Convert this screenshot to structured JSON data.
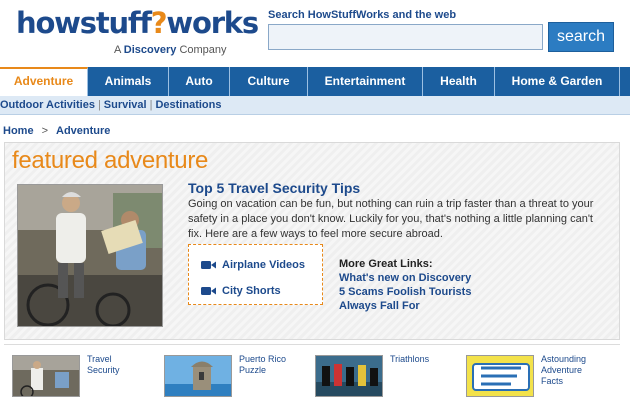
{
  "header": {
    "logo_text_part1": "howstuff",
    "logo_text_part2": "works",
    "logo_question": "?",
    "logo_tagline_prefix": "A",
    "logo_tagline_brand": "Discovery",
    "logo_tagline_suffix": "Company",
    "search_label": "Search HowStuffWorks and the web",
    "search_value": "",
    "search_button": "search"
  },
  "nav": {
    "items": [
      {
        "label": "Adventure",
        "active": true
      },
      {
        "label": "Animals",
        "active": false
      },
      {
        "label": "Auto",
        "active": false
      },
      {
        "label": "Culture",
        "active": false
      },
      {
        "label": "Entertainment",
        "active": false
      },
      {
        "label": "Health",
        "active": false
      },
      {
        "label": "Home & Garden",
        "active": false
      }
    ]
  },
  "subnav": {
    "items": [
      "Outdoor Activities",
      "Survival",
      "Destinations"
    ],
    "separator": "|"
  },
  "breadcrumb": {
    "home": "Home",
    "separator": ">",
    "current": "Adventure"
  },
  "feature": {
    "section_title": "featured adventure",
    "article_title": "Top 5 Travel Security Tips",
    "article_body": "Going on vacation can be fun, but nothing can ruin a trip faster than a threat to your safety in a place you don't know. Luckily for you, that's nothing a little planning can't fix. Here are a few ways to feel more secure abroad.",
    "video_links": [
      "Airplane Videos",
      "City Shorts"
    ],
    "more_links_heading": "More Great Links:",
    "more_links": [
      "What's new on Discovery",
      "5 Scams Foolish Tourists",
      "Always Fall For"
    ]
  },
  "strip": {
    "items": [
      {
        "label_line1": "Travel",
        "label_line2": "Security",
        "label_line3": ""
      },
      {
        "label_line1": "Puerto Rico",
        "label_line2": "Puzzle",
        "label_line3": ""
      },
      {
        "label_line1": "Triathlons",
        "label_line2": "",
        "label_line3": ""
      },
      {
        "label_line1": "Astounding",
        "label_line2": "Adventure",
        "label_line3": "Facts"
      }
    ]
  },
  "colors": {
    "brand_blue": "#1d4a8c",
    "nav_blue": "#1b5fa0",
    "accent_orange": "#e8891a",
    "search_button": "#2c7cc2"
  },
  "icons": {
    "video": "video-camera-icon",
    "logo_question": "question-mark-icon"
  }
}
